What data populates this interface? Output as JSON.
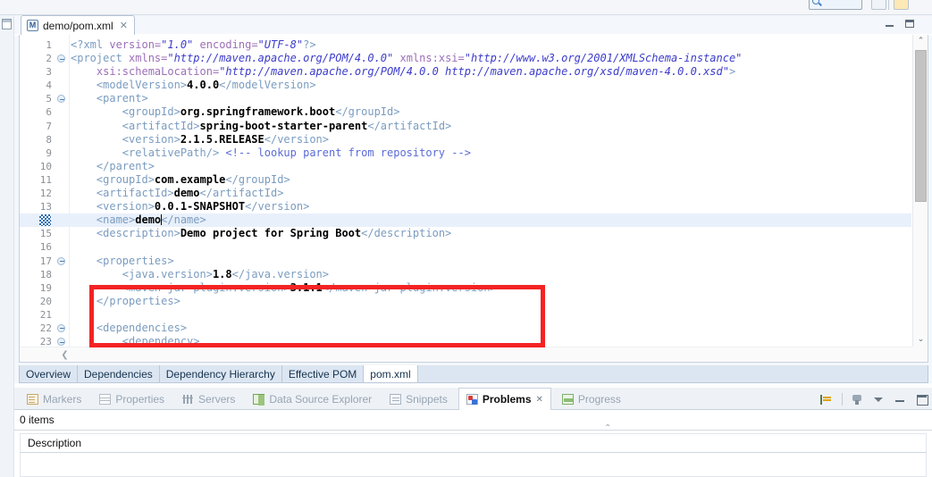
{
  "top_toolbar": {
    "search_placeholder": "",
    "buttons": [
      "toolbar-button-1",
      "toolbar-button-2"
    ]
  },
  "window": {
    "minimize_label": "Minimize",
    "maximize_label": "Maximize"
  },
  "editor": {
    "tab": {
      "icon": "maven-pom-icon",
      "icon_letter": "M",
      "title": "demo/pom.xml",
      "close": "✕"
    },
    "form_tabs": [
      {
        "label": "Overview",
        "active": false
      },
      {
        "label": "Dependencies",
        "active": false
      },
      {
        "label": "Dependency Hierarchy",
        "active": false
      },
      {
        "label": "Effective POM",
        "active": false
      },
      {
        "label": "pom.xml",
        "active": true
      }
    ],
    "scroll": {
      "up_arrow": "⌃",
      "down_arrow": "⌄",
      "left_arrow": "❮"
    },
    "annotation": {
      "shape": "rectangle",
      "color": "#f42323",
      "covers_lines": "17-20"
    },
    "current_line": 14,
    "lines": [
      {
        "n": 1,
        "fold": false,
        "dirty": false,
        "tokens": [
          {
            "c": "tg",
            "t": "<?xml "
          },
          {
            "c": "at",
            "t": "version="
          },
          {
            "c": "st",
            "t": "\"1.0\""
          },
          {
            "c": "tg",
            "t": " "
          },
          {
            "c": "at",
            "t": "encoding="
          },
          {
            "c": "st",
            "t": "\"UTF-8\""
          },
          {
            "c": "tg",
            "t": "?>"
          }
        ]
      },
      {
        "n": 2,
        "fold": true,
        "dirty": false,
        "tokens": [
          {
            "c": "tg",
            "t": "<project "
          },
          {
            "c": "at",
            "t": "xmlns="
          },
          {
            "c": "st",
            "t": "\"http://maven.apache.org/POM/4.0.0\""
          },
          {
            "c": "tg",
            "t": " "
          },
          {
            "c": "at",
            "t": "xmlns:xsi="
          },
          {
            "c": "st",
            "t": "\"http://www.w3.org/2001/XMLSchema-instance\""
          }
        ]
      },
      {
        "n": 3,
        "fold": false,
        "dirty": false,
        "tokens": [
          {
            "c": "tg",
            "t": "    "
          },
          {
            "c": "at",
            "t": "xsi:schemaLocation="
          },
          {
            "c": "st",
            "t": "\"http://maven.apache.org/POM/4.0.0 http://maven.apache.org/xsd/maven-4.0.0.xsd\""
          },
          {
            "c": "tg",
            "t": ">"
          }
        ]
      },
      {
        "n": 4,
        "fold": false,
        "dirty": false,
        "tokens": [
          {
            "c": "tg",
            "t": "    <modelVersion>"
          },
          {
            "c": "tx",
            "t": "4.0.0"
          },
          {
            "c": "tg",
            "t": "</modelVersion>"
          }
        ]
      },
      {
        "n": 5,
        "fold": true,
        "dirty": false,
        "tokens": [
          {
            "c": "tg",
            "t": "    <parent>"
          }
        ]
      },
      {
        "n": 6,
        "fold": false,
        "dirty": false,
        "tokens": [
          {
            "c": "tg",
            "t": "        <groupId>"
          },
          {
            "c": "tx",
            "t": "org.springframework.boot"
          },
          {
            "c": "tg",
            "t": "</groupId>"
          }
        ]
      },
      {
        "n": 7,
        "fold": false,
        "dirty": false,
        "tokens": [
          {
            "c": "tg",
            "t": "        <artifactId>"
          },
          {
            "c": "tx",
            "t": "spring-boot-starter-parent"
          },
          {
            "c": "tg",
            "t": "</artifactId>"
          }
        ]
      },
      {
        "n": 8,
        "fold": false,
        "dirty": false,
        "tokens": [
          {
            "c": "tg",
            "t": "        <version>"
          },
          {
            "c": "tx",
            "t": "2.1.5.RELEASE"
          },
          {
            "c": "tg",
            "t": "</version>"
          }
        ]
      },
      {
        "n": 9,
        "fold": false,
        "dirty": false,
        "tokens": [
          {
            "c": "tg",
            "t": "        <relativePath/>"
          },
          {
            "c": "cm",
            "t": " <!-- lookup parent from repository -->"
          }
        ]
      },
      {
        "n": 10,
        "fold": false,
        "dirty": false,
        "tokens": [
          {
            "c": "tg",
            "t": "    </parent>"
          }
        ]
      },
      {
        "n": 11,
        "fold": false,
        "dirty": false,
        "tokens": [
          {
            "c": "tg",
            "t": "    <groupId>"
          },
          {
            "c": "tx",
            "t": "com.example"
          },
          {
            "c": "tg",
            "t": "</groupId>"
          }
        ]
      },
      {
        "n": 12,
        "fold": false,
        "dirty": false,
        "tokens": [
          {
            "c": "tg",
            "t": "    <artifactId>"
          },
          {
            "c": "tx",
            "t": "demo"
          },
          {
            "c": "tg",
            "t": "</artifactId>"
          }
        ]
      },
      {
        "n": 13,
        "fold": false,
        "dirty": false,
        "tokens": [
          {
            "c": "tg",
            "t": "    <version>"
          },
          {
            "c": "tx",
            "t": "0.0.1-SNAPSHOT"
          },
          {
            "c": "tg",
            "t": "</version>"
          }
        ]
      },
      {
        "n": 14,
        "fold": false,
        "dirty": true,
        "current": true,
        "tokens": [
          {
            "c": "tg",
            "t": "    <name>"
          },
          {
            "c": "tx",
            "t": "demo"
          },
          {
            "c": "caret",
            "t": ""
          },
          {
            "c": "tg",
            "t": "</name>"
          }
        ]
      },
      {
        "n": 15,
        "fold": false,
        "dirty": false,
        "tokens": [
          {
            "c": "tg",
            "t": "    <description>"
          },
          {
            "c": "tx",
            "t": "Demo project for Spring Boot"
          },
          {
            "c": "tg",
            "t": "</description>"
          }
        ]
      },
      {
        "n": 16,
        "fold": false,
        "dirty": false,
        "tokens": []
      },
      {
        "n": 17,
        "fold": true,
        "dirty": false,
        "tokens": [
          {
            "c": "tg",
            "t": "    <properties>"
          }
        ]
      },
      {
        "n": 18,
        "fold": false,
        "dirty": false,
        "tokens": [
          {
            "c": "tg",
            "t": "        <java.version>"
          },
          {
            "c": "tx",
            "t": "1.8"
          },
          {
            "c": "tg",
            "t": "</java.version>"
          }
        ]
      },
      {
        "n": 19,
        "fold": false,
        "dirty": false,
        "tokens": [
          {
            "c": "tg",
            "t": "        <maven-jar-plugin.version>"
          },
          {
            "c": "tx",
            "t": "3.1.1"
          },
          {
            "c": "tg",
            "t": "</maven-jar-plugin.version>"
          }
        ]
      },
      {
        "n": 20,
        "fold": false,
        "dirty": false,
        "tokens": [
          {
            "c": "tg",
            "t": "    </properties>"
          }
        ]
      },
      {
        "n": 21,
        "fold": false,
        "dirty": false,
        "tokens": []
      },
      {
        "n": 22,
        "fold": true,
        "dirty": false,
        "tokens": [
          {
            "c": "tg",
            "t": "    <dependencies>"
          }
        ]
      },
      {
        "n": 23,
        "fold": true,
        "dirty": false,
        "tokens": [
          {
            "c": "tg",
            "t": "        <dependency>"
          }
        ]
      }
    ]
  },
  "bottom_view": {
    "tabs": [
      {
        "label": "Markers",
        "icon": "markers-icon",
        "active": false
      },
      {
        "label": "Properties",
        "icon": "properties-icon",
        "active": false
      },
      {
        "label": "Servers",
        "icon": "servers-icon",
        "active": false
      },
      {
        "label": "Data Source Explorer",
        "icon": "data-source-explorer-icon",
        "active": false
      },
      {
        "label": "Snippets",
        "icon": "snippets-icon",
        "active": false
      },
      {
        "label": "Problems",
        "icon": "problems-icon",
        "active": true,
        "close": "✕"
      },
      {
        "label": "Progress",
        "icon": "progress-icon",
        "active": false
      }
    ],
    "toolbar": [
      "focus-on-selection-icon",
      "filters-icon",
      "view-menu-icon",
      "minimize-icon",
      "maximize-icon"
    ],
    "items_count": "0 items",
    "columns": [
      "Description"
    ],
    "rows": [],
    "sash_arrow": "⌃"
  }
}
